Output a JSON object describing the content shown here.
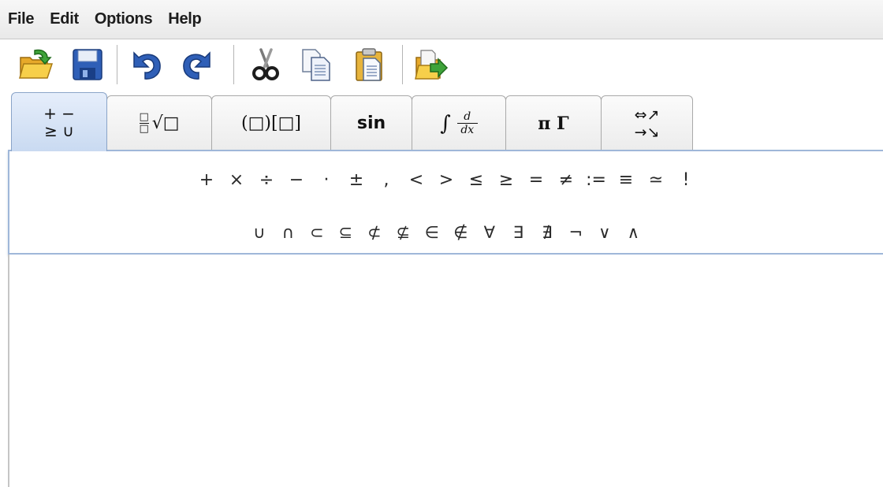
{
  "menubar": {
    "items": [
      "File",
      "Edit",
      "Options",
      "Help"
    ]
  },
  "toolbar": {
    "buttons": [
      {
        "name": "open-icon",
        "label": "Open"
      },
      {
        "name": "save-icon",
        "label": "Save"
      },
      {
        "name": "undo-icon",
        "label": "Undo"
      },
      {
        "name": "redo-icon",
        "label": "Redo"
      },
      {
        "name": "cut-icon",
        "label": "Cut"
      },
      {
        "name": "copy-icon",
        "label": "Copy"
      },
      {
        "name": "paste-icon",
        "label": "Paste"
      },
      {
        "name": "export-icon",
        "label": "Export"
      }
    ]
  },
  "tabs": {
    "operators": {
      "line1": "+ −",
      "line2": "≥ ∪"
    },
    "fraction_root": {
      "fraction": "□",
      "root": "√□"
    },
    "brackets": "(□)[□]",
    "functions": "sin",
    "calculus": {
      "integral": "∫",
      "num": "d",
      "den": "dx"
    },
    "greek": "π Γ",
    "arrows": {
      "line1": "⇔↗",
      "line2": "→↘"
    }
  },
  "palette": {
    "row1": [
      "+",
      "×",
      "÷",
      "−",
      "·",
      "±",
      ",",
      "<",
      ">",
      "≤",
      "≥",
      "=",
      "≠",
      ":=",
      "≡",
      "≃",
      "!"
    ],
    "row2": [
      "∪",
      "∩",
      "⊂",
      "⊆",
      "⊄",
      "⊈",
      "∈",
      "∉",
      "∀",
      "∃",
      "∄",
      "¬",
      "∨",
      "∧"
    ]
  },
  "colors": {
    "accent_blue": "#2f5fb7",
    "folder_yellow": "#f2c23a",
    "arrow_green": "#3ea33a",
    "selected_tab": "#c9daf1"
  }
}
